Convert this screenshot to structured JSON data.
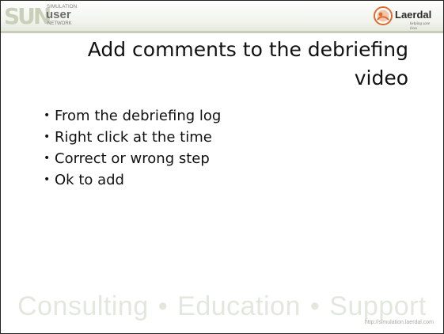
{
  "logo": {
    "sun_letters": "SUN",
    "small_top": "SIMULATION",
    "user": "user",
    "network": "NETWORK"
  },
  "laerdal": {
    "name": "Laerdal",
    "tagline": "helping save lives",
    "colors": {
      "mark": "#e06a2a"
    }
  },
  "slide": {
    "title_line1": "Add comments to the debriefing",
    "title_line2": "video",
    "bullets": [
      "From the debriefing log",
      "Right click at the time",
      "Correct or wrong step",
      "Ok to add"
    ],
    "bullet_symbol": "•"
  },
  "footer": {
    "word1": "Consulting",
    "word2": "Education",
    "word3": "Support",
    "separator": "•",
    "url": "http://simulation.laerdal.com"
  }
}
